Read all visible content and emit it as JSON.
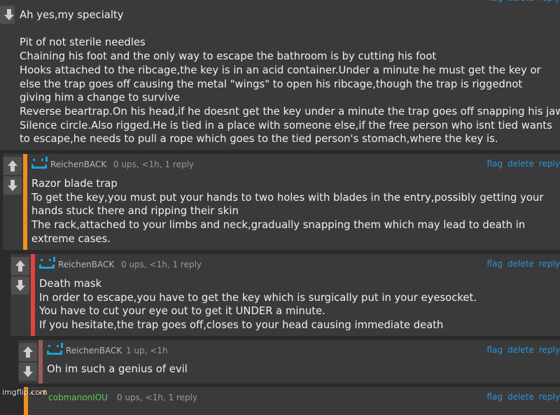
{
  "comments": [
    {
      "body": [
        "Ah yes,my specialty",
        "",
        "Pit of not sterile needles",
        "Chaining his foot and the only way to escape the bathroom is by cutting his foot",
        "Hooks attached to the ribcage,the key is in an acid container.Under a minute he must get the key or else the trap goes off causing the metal \"wings\" to open his ribcage,though the trap is riggednot giving him a change to survive",
        "Reverse beartrap.On his head,if he doesnt get the key under a minute the trap goes off snapping his jaw.",
        "Silence circle.Also rigged.He is tied in a place with someone else,if the free person who isnt tied wants to escape,he needs to pull a rope which goes to the tied person's stomach,where the key is."
      ]
    },
    {
      "user": "ReichenBACK",
      "stats": "0 ups, <1h, 1 reply",
      "bar_color": "#f0901e",
      "body": [
        "Razor blade trap",
        "To get the key,you must put your hands to two holes with blades in the entry,possibly getting your hands stuck there and ripping their skin",
        "The rack,attached to your limbs and neck,gradually snapping them which may lead to death in extreme cases."
      ]
    },
    {
      "user": "ReichenBACK",
      "stats": "0 ups, <1h, 1 reply",
      "bar_color": "#e0443c",
      "body": [
        "Death mask",
        "In order to escape,you have to get the key which is surgically put in your eyesocket.",
        "You have to cut your eye out to get it UNDER a minute.",
        "If you hesitate,the trap goes off,closes to your head causing immediate death"
      ]
    },
    {
      "user": "ReichenBACK",
      "stats": "1 up, <1h",
      "bar_color": "#9b5a5a",
      "body": [
        "Oh im such a genius of evil"
      ]
    },
    {
      "user": "cobmanonIOU",
      "stats": "0 ups, <1h, 1 reply",
      "bar_color": "#f0901e"
    }
  ],
  "actions": {
    "flag": "flag",
    "delete": "delete",
    "reply": "reply"
  },
  "watermark": "imgflip.com",
  "colors": {
    "link": "#2b95d6",
    "avatar": "#1ea0d8",
    "background": "#2b2b2b",
    "comment_bg": "#3a3a3a"
  }
}
